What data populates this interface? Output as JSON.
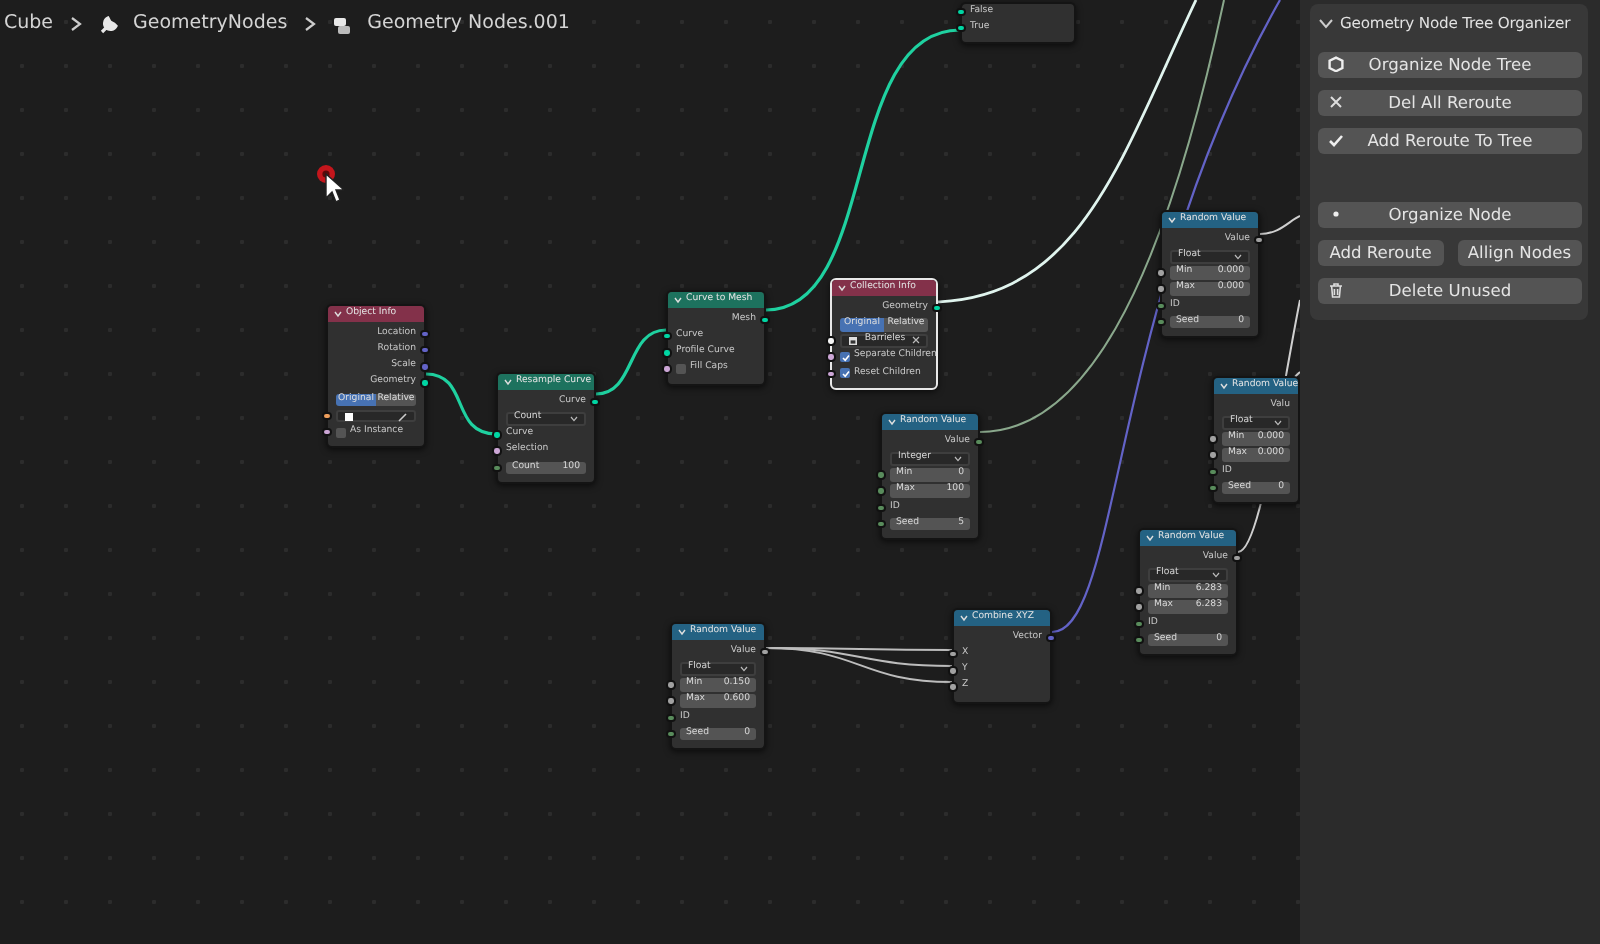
{
  "breadcrumb": [
    {
      "label": "Cube"
    },
    {
      "label": "GeometryNodes"
    },
    {
      "label": "Geometry Nodes.001"
    }
  ],
  "nodes": [
    {
      "title": "Object Info",
      "color": "#83314a",
      "selected": false,
      "rows": [
        {
          "kind": "output",
          "label": "Location",
          "color": "#6363c7"
        },
        {
          "kind": "output",
          "label": "Rotation",
          "color": "#6363c7"
        },
        {
          "kind": "output",
          "label": "Scale",
          "color": "#6363c7"
        },
        {
          "kind": "output",
          "label": "Geometry",
          "color": "#00d6a3"
        },
        {
          "kind": "toggle",
          "options": [
            {
              "label": "Original",
              "selected": true
            },
            {
              "label": "Relative",
              "selected": false
            }
          ]
        },
        {
          "kind": "object",
          "color": "#ed9e5c"
        },
        {
          "kind": "checkbox",
          "label": "As Instance",
          "checked": false,
          "color": "#cca6d6"
        }
      ]
    },
    {
      "title": "Resample Curve",
      "color": "#1d725e",
      "selected": false,
      "rows": [
        {
          "kind": "output",
          "label": "Curve",
          "color": "#00d6a3"
        },
        {
          "kind": "dropdown",
          "value": "Count"
        },
        {
          "kind": "input",
          "label": "Curve",
          "color": "#00d6a3"
        },
        {
          "kind": "input",
          "label": "Selection",
          "color": "#cca6d6"
        },
        {
          "kind": "field",
          "label": "Count",
          "value": "100",
          "color": "#598c5c"
        }
      ]
    },
    {
      "title": "Curve to Mesh",
      "color": "#1d725e",
      "selected": false,
      "rows": [
        {
          "kind": "output",
          "label": "Mesh",
          "color": "#00d6a3"
        },
        {
          "kind": "input",
          "label": "Curve",
          "color": "#00d6a3"
        },
        {
          "kind": "input",
          "label": "Profile Curve",
          "color": "#00d6a3"
        },
        {
          "kind": "checkbox",
          "label": "Fill Caps",
          "checked": false,
          "color": "#cca6d6"
        }
      ]
    },
    {
      "title": "Collection Info",
      "color": "#83314a",
      "selected": true,
      "rows": [
        {
          "kind": "output",
          "label": "Geometry",
          "color": "#00d6a3"
        },
        {
          "kind": "toggle",
          "options": [
            {
              "label": "Original",
              "selected": true
            },
            {
              "label": "Relative",
              "selected": false
            }
          ]
        },
        {
          "kind": "collection",
          "value": "Barrieles",
          "color": "#f5f5f5"
        },
        {
          "kind": "checkbox",
          "label": "Separate Children",
          "checked": true,
          "color": "#cca6d6"
        },
        {
          "kind": "checkbox",
          "label": "Reset Children",
          "checked": true,
          "color": "#cca6d6"
        }
      ]
    },
    {
      "title": "Random Value",
      "color": "#246283",
      "selected": false,
      "rows": [
        {
          "kind": "output",
          "label": "Value",
          "color": "#598c5c"
        },
        {
          "kind": "dropdown",
          "value": "Integer"
        },
        {
          "kind": "field",
          "label": "Min",
          "value": "0",
          "color": "#598c5c"
        },
        {
          "kind": "field",
          "label": "Max",
          "value": "100",
          "color": "#598c5c"
        },
        {
          "kind": "input",
          "label": "ID",
          "color": "#598c5c"
        },
        {
          "kind": "field",
          "label": "Seed",
          "value": "5",
          "color": "#598c5c"
        }
      ]
    },
    {
      "title": "Random Value",
      "color": "#246283",
      "selected": false,
      "rows": [
        {
          "kind": "output",
          "label": "Value",
          "color": "#a1a1a1"
        },
        {
          "kind": "dropdown",
          "value": "Float"
        },
        {
          "kind": "field",
          "label": "Min",
          "value": "0.000",
          "color": "#a1a1a1"
        },
        {
          "kind": "field",
          "label": "Max",
          "value": "0.000",
          "color": "#a1a1a1"
        },
        {
          "kind": "input",
          "label": "ID",
          "color": "#598c5c"
        },
        {
          "kind": "field",
          "label": "Seed",
          "value": "0",
          "color": "#598c5c"
        }
      ]
    },
    {
      "title": "Random Value",
      "color": "#246283",
      "selected": false,
      "rows": [
        {
          "kind": "output",
          "label": "Valu"
        },
        {
          "kind": "dropdown",
          "value": "Float"
        },
        {
          "kind": "field",
          "label": "Min",
          "value": "0.000",
          "color": "#a1a1a1"
        },
        {
          "kind": "field",
          "label": "Max",
          "value": "0.000",
          "color": "#a1a1a1"
        },
        {
          "kind": "input",
          "label": "ID",
          "color": "#598c5c"
        },
        {
          "kind": "field",
          "label": "Seed",
          "value": "0",
          "color": "#598c5c"
        }
      ]
    },
    {
      "title": "Random Value",
      "color": "#246283",
      "selected": false,
      "rows": [
        {
          "kind": "output",
          "label": "Value",
          "color": "#a1a1a1"
        },
        {
          "kind": "dropdown",
          "value": "Float"
        },
        {
          "kind": "field",
          "label": "Min",
          "value": "6.283",
          "color": "#a1a1a1"
        },
        {
          "kind": "field",
          "label": "Max",
          "value": "6.283",
          "color": "#a1a1a1"
        },
        {
          "kind": "input",
          "label": "ID",
          "color": "#598c5c"
        },
        {
          "kind": "field",
          "label": "Seed",
          "value": "0",
          "color": "#598c5c"
        }
      ]
    },
    {
      "title": "Combine XYZ",
      "color": "#246283",
      "selected": false,
      "rows": [
        {
          "kind": "output",
          "label": "Vector",
          "color": "#6363c7"
        },
        {
          "kind": "input",
          "label": "X",
          "color": "#a1a1a1"
        },
        {
          "kind": "input",
          "label": "Y",
          "color": "#a1a1a1"
        },
        {
          "kind": "input",
          "label": "Z",
          "color": "#a1a1a1"
        }
      ]
    },
    {
      "title": "Random Value",
      "color": "#246283",
      "selected": false,
      "rows": [
        {
          "kind": "output",
          "label": "Value",
          "color": "#a1a1a1"
        },
        {
          "kind": "dropdown",
          "value": "Float"
        },
        {
          "kind": "field",
          "label": "Min",
          "value": "0.150",
          "color": "#a1a1a1"
        },
        {
          "kind": "field",
          "label": "Max",
          "value": "0.600",
          "color": "#a1a1a1"
        },
        {
          "kind": "input",
          "label": "ID",
          "color": "#598c5c"
        },
        {
          "kind": "field",
          "label": "Seed",
          "value": "0",
          "color": "#598c5c"
        }
      ]
    },
    {
      "selected": false,
      "rows": [
        {
          "kind": "input",
          "label": "False",
          "color": "#00d6a3"
        },
        {
          "kind": "input",
          "label": "True",
          "color": "#00d6a3"
        }
      ]
    }
  ],
  "panel": {
    "title": "Geometry Node Tree Organizer",
    "expanded": true,
    "groups": [
      [
        {
          "label": "Organize Node Tree"
        }
      ],
      [
        {
          "label": "Del All Reroute"
        }
      ],
      [
        {
          "label": "Add Reroute To Tree"
        }
      ],
      [
        {
          "label": "Organize Node"
        }
      ],
      [
        {
          "label": "Add Reroute"
        },
        {
          "label": "Allign Nodes"
        }
      ],
      [
        {
          "label": "Delete Unused"
        }
      ]
    ]
  }
}
